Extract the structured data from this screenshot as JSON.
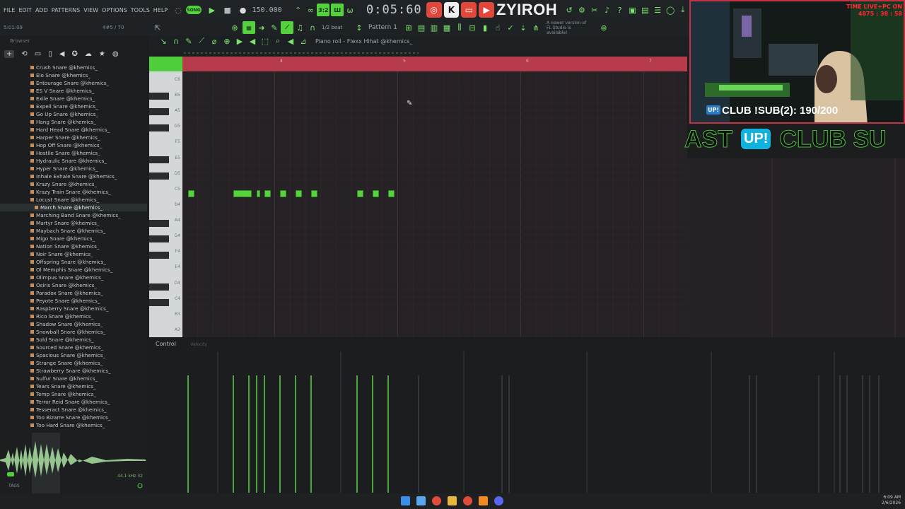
{
  "menu": [
    "FILE",
    "EDIT",
    "ADD",
    "PATTERNS",
    "VIEW",
    "OPTIONS",
    "TOOLS",
    "HELP"
  ],
  "toolbar": {
    "song_mode": "SONG",
    "tempo": "150.000",
    "time": "0:05:60",
    "streamer_name": "ZYIROH",
    "snap": "1/2 beat",
    "pattern": "Pattern 1",
    "update_notice_line1": "A newer version of",
    "update_notice_line2": "FL Studio is available!",
    "position_display": "5:01:09",
    "cpu_display": "4#5 / 70"
  },
  "browser": {
    "title": "Browser",
    "items": [
      "Crush Snare @khemics_",
      "Elo Snare @khemics_",
      "Entourage Snare @khemics_",
      "ES V Snare @khemics_",
      "Exile Snare @khemics_",
      "Expell Snare @khemics_",
      "Go Up Snare @khemics_",
      "Hang Snare @khemics_",
      "Hard Head Snare @khemics_",
      "Harper Snare @khemics_",
      "Hop Off Snare @khemics_",
      "Hostile Snare @khemics_",
      "Hydraulic Snare @khemics_",
      "Hyper Snare @khemics_",
      "Inhale Exhale Snare @khemics_",
      "Krazy Snare @khemics_",
      "Krazy Train Snare @khemics_",
      "Locust Snare @khemics_",
      "March Snare @khemics_",
      "Marching Band Snare @khemics_",
      "Martyr Snare @khemics_",
      "Maybach Snare @khemics_",
      "Migo Snare @khemics_",
      "Nation Snare @khemics_",
      "Noir Snare @khemics_",
      "Offspring Snare @khemics_",
      "Ol Memphis Snare @khemics_",
      "Olimpus Snare @khemics_",
      "Osiris Snare @khemics_",
      "Paradox Snare @khemics_",
      "Peyote Snare @khemics_",
      "Raspberry Snare @khemics_",
      "Rico Snare @khemics_",
      "Shadow Snare @khemics_",
      "Snowball Snare @khemics_",
      "Sold Snare @khemics_",
      "Sourced Snare @khemics_",
      "Spacious Snare @khemics_",
      "Strange Snare @khemics_",
      "Strawberry Snare @khemics_",
      "Sulfur Snare @khemics_",
      "Tears Snare @khemics_",
      "Temp Snare @khemics_",
      "Terror Reid Snare @khemics_",
      "Tesseract Snare @khemics_",
      "Too Bizarre Snare @khemics_",
      "Too Hard Snare @khemics_"
    ],
    "selected_index": 18,
    "preview_freq": "44.1 kHz 32",
    "tags_label": "TAGS"
  },
  "piano_roll": {
    "title": "Piano roll - Flexx Hihat @khemics_",
    "bar_numbers": [
      "4",
      "5",
      "6",
      "7"
    ],
    "key_labels": [
      "C6",
      "B5",
      "A5",
      "G5",
      "F5",
      "E5",
      "D5",
      "C5",
      "B4",
      "A4",
      "G4",
      "F4",
      "E4",
      "D4",
      "C4",
      "B3",
      "A3"
    ],
    "notes_pitch": "C5",
    "control_label": "Control",
    "control_sub": "Velocity"
  },
  "stream": {
    "cam_label": "CLUB !SUB(2): 190/200",
    "cam_badge": "UP!",
    "live_text_1": "TIME LIVE+PC ON",
    "live_text_2": "4875 : 38 : 58",
    "ticker_left": "AST",
    "ticker_badge": "UP!",
    "ticker_right": "CLUB SU"
  },
  "taskbar": {
    "time": "6:09 AM",
    "date": "2/6/2026"
  },
  "colors": {
    "accent_green": "#54d13c",
    "timeline_red": "#b73c4b",
    "grid_bg": "#262124"
  }
}
